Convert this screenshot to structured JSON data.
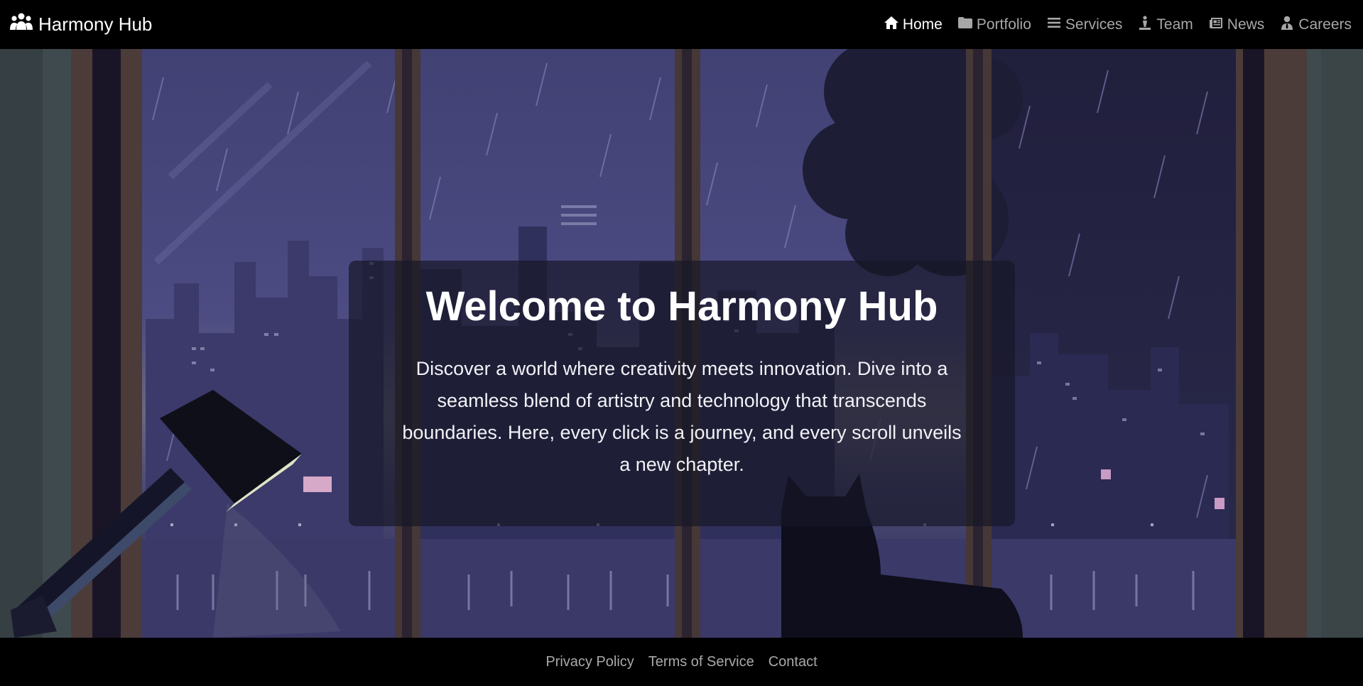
{
  "brand": {
    "name": "Harmony Hub",
    "icon": "users-icon"
  },
  "nav": {
    "items": [
      {
        "label": "Home",
        "icon": "home-icon",
        "active": true
      },
      {
        "label": "Portfolio",
        "icon": "folder-icon",
        "active": false
      },
      {
        "label": "Services",
        "icon": "list-icon",
        "active": false
      },
      {
        "label": "Team",
        "icon": "person-icon",
        "active": false
      },
      {
        "label": "News",
        "icon": "newspaper-icon",
        "active": false
      },
      {
        "label": "Careers",
        "icon": "user-tie-icon",
        "active": false
      }
    ]
  },
  "hero": {
    "title": "Welcome to Harmony Hub",
    "text": "Discover a world where creativity meets innovation. Dive into a seamless blend of artistry and technology that transcends boundaries. Here, every click is a journey, and every scroll unveils a new chapter."
  },
  "footer": {
    "links": [
      "Privacy Policy",
      "Terms of Service",
      "Contact"
    ]
  },
  "colors": {
    "background": "#000000",
    "nav_active": "#ffffff",
    "nav_inactive": "#a7a7a7",
    "sky": "#4a4a80",
    "card": "#16162a"
  }
}
